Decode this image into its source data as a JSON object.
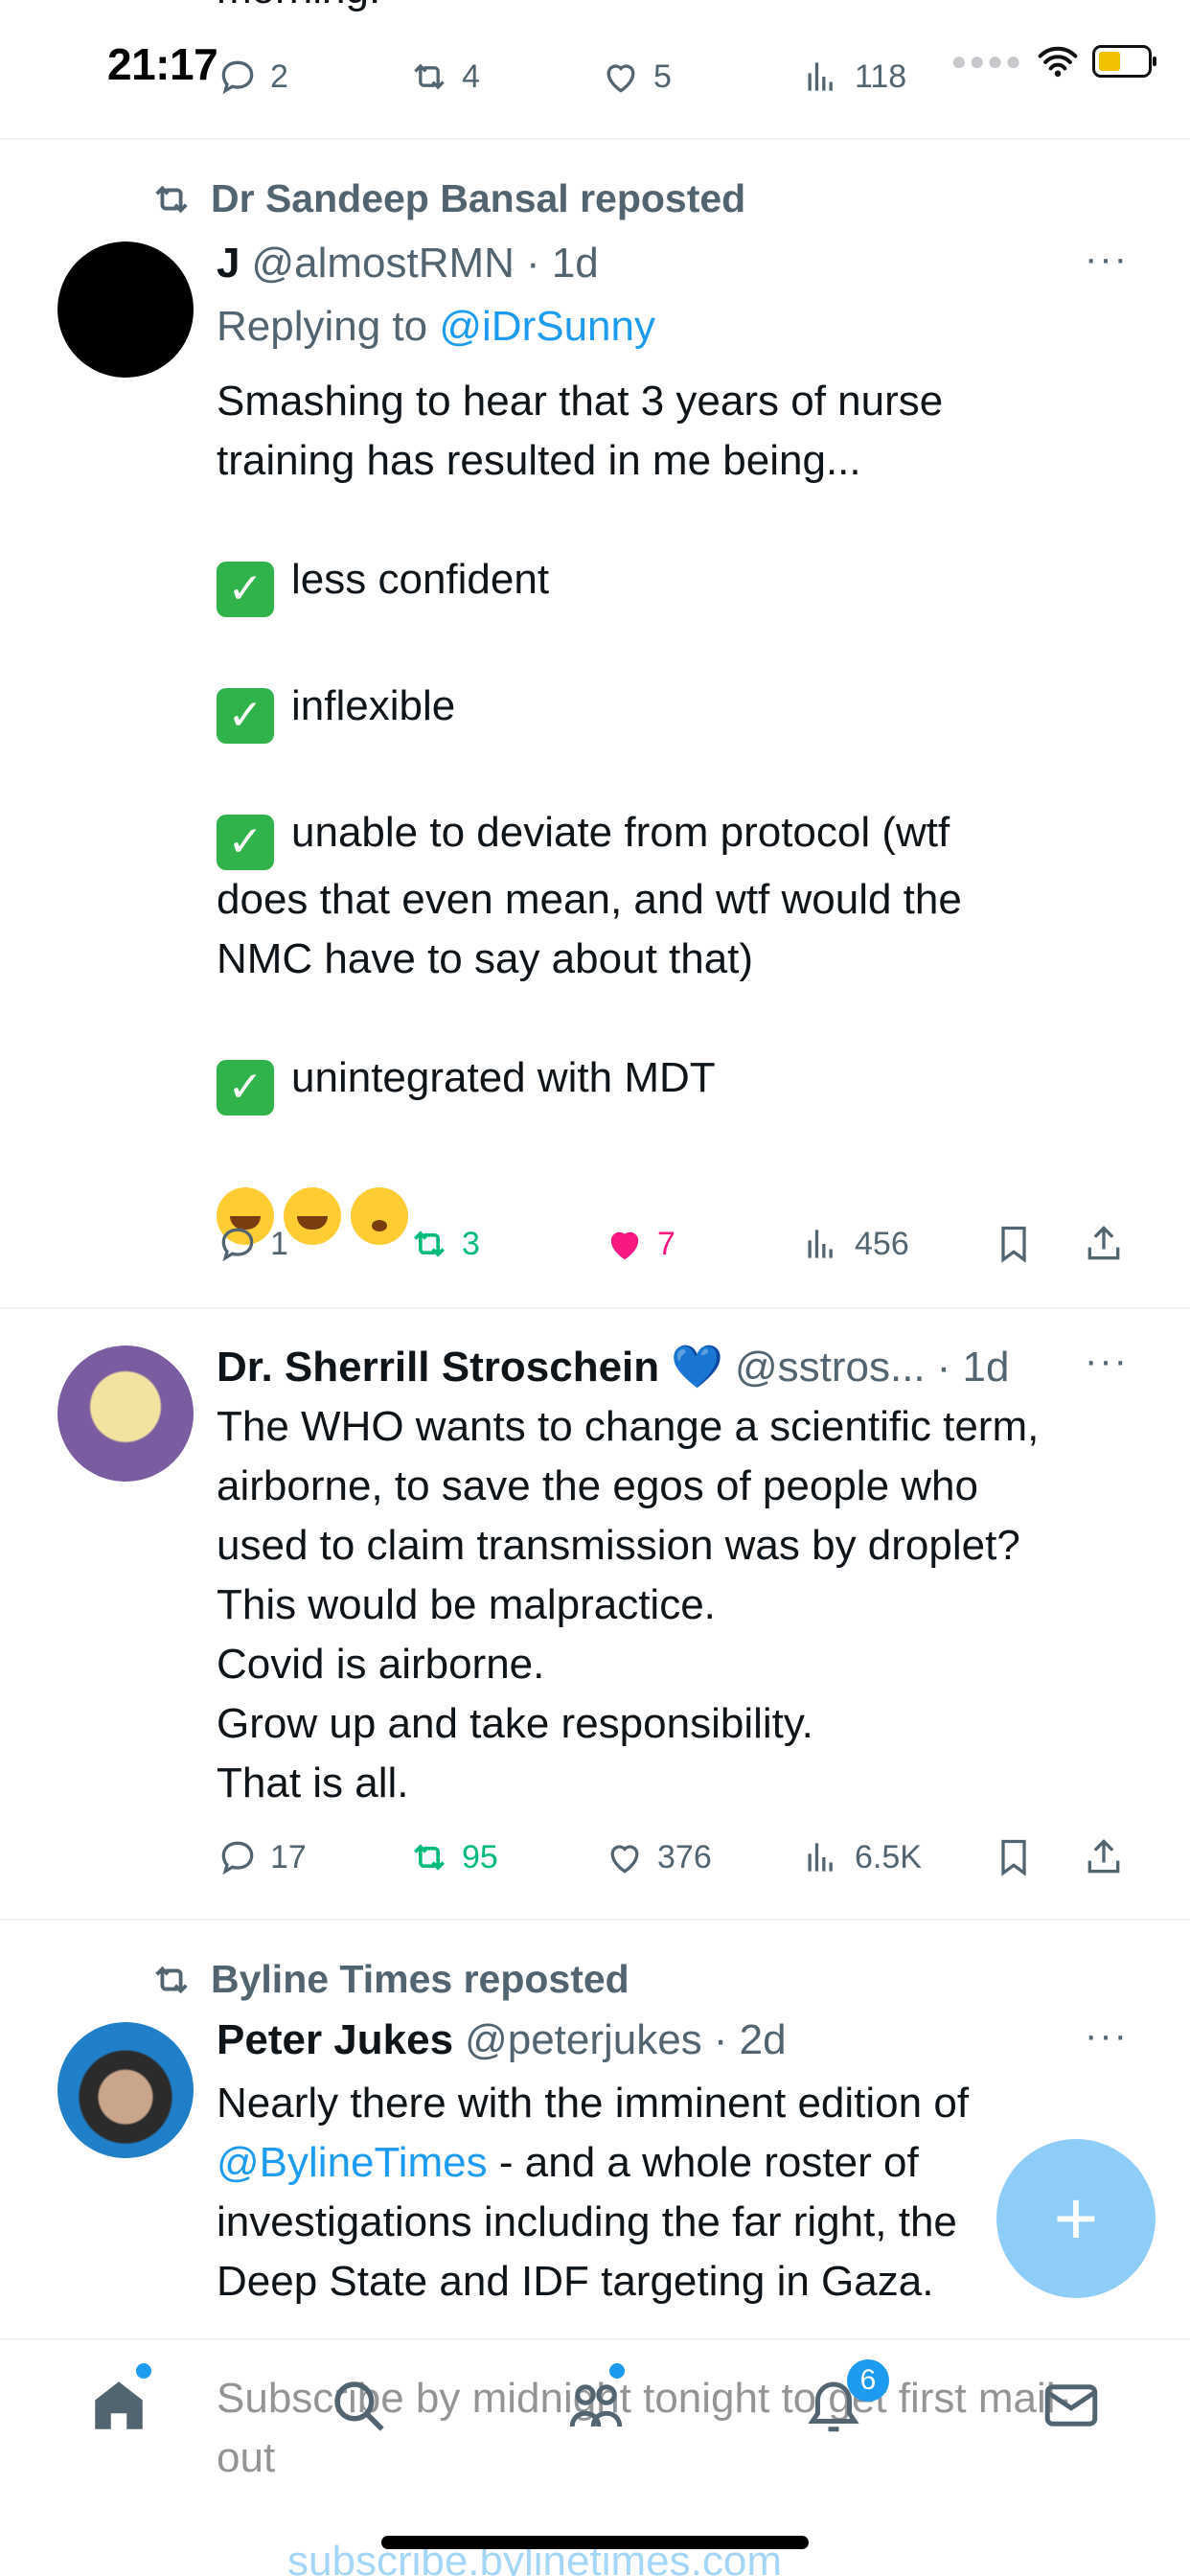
{
  "status_bar": {
    "time": "21:17"
  },
  "partial_tweet": {
    "text_tail": "morning.",
    "actions": {
      "replies": "2",
      "reposts": "4",
      "likes": "5",
      "views": "118"
    }
  },
  "tweets": [
    {
      "repost_by": "Dr Sandeep Bansal reposted",
      "name": "J",
      "handle": "@almostRMN",
      "time": "· 1d",
      "replying_prefix": "Replying to ",
      "replying_to": "@iDrSunny",
      "lines": {
        "intro1": "Smashing to hear that 3 years of nurse",
        "intro2": "training has resulted in me being...",
        "item1": "less confident",
        "item2": "inflexible",
        "item3a": "unable to deviate from protocol (wtf",
        "item3b": "does that even mean, and wtf would the",
        "item3c": "NMC have to say about that)",
        "item4": "unintegrated with MDT"
      },
      "actions": {
        "replies": "1",
        "reposts": "3",
        "likes": "7",
        "views": "456"
      }
    },
    {
      "name": "Dr. Sherrill Stroschein",
      "name_emoji": "💙",
      "handle": "@sstros...",
      "time": "· 1d",
      "lines": {
        "l1": "The WHO wants to change a scientific term,",
        "l2": "airborne, to save the egos of people who",
        "l3": "used to claim transmission was by droplet?",
        "l4": "This would be malpractice.",
        "l5": "Covid is airborne.",
        "l6": "Grow up and take responsibility.",
        "l7": "That is all."
      },
      "actions": {
        "replies": "17",
        "reposts": "95",
        "likes": "376",
        "views": "6.5K"
      }
    },
    {
      "repost_by": "Byline Times reposted",
      "name": "Peter Jukes",
      "handle": "@peterjukes",
      "time": "· 2d",
      "lines": {
        "l1": "Nearly there with the imminent edition of",
        "l2_link": "@BylineTimes",
        "l2_rest": " - and a whole roster of",
        "l3": "investigations including the far right, the",
        "l4": "Deep State and IDF targeting in Gaza."
      },
      "under_nav_text": "Subscribe by midnight tonight to get first mail-out",
      "under_nav_link": "subscribe.bylinetimes.com"
    }
  ],
  "more_glyph": "···",
  "fab_glyph": "+",
  "nav": {
    "notifications_badge": "6"
  },
  "icons": [
    "reply-icon",
    "repost-icon",
    "like-icon",
    "views-icon",
    "bookmark-icon",
    "share-icon",
    "home-icon",
    "search-icon",
    "communities-icon",
    "notifications-icon",
    "messages-icon"
  ],
  "colors": {
    "link": "#1d9bf0",
    "repost_active": "#00ba7c",
    "like_active": "#f91880",
    "muted": "#536471",
    "fab": "#8ecdf7"
  }
}
